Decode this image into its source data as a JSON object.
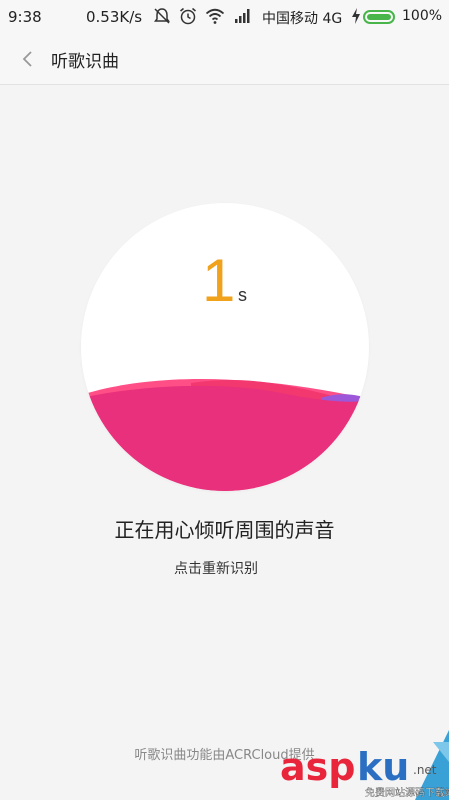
{
  "status_bar": {
    "time": "9:38",
    "speed": "0.53K/s",
    "carrier": "中国移动 4G",
    "battery": "100%",
    "icons": [
      "mute-icon",
      "alarm-icon",
      "wifi-icon",
      "signal-icon",
      "charging-icon",
      "battery-icon"
    ],
    "battery_color": "#48b54a"
  },
  "header": {
    "title": "听歌识曲",
    "back_icon": "chevron-left-icon"
  },
  "recognizer": {
    "count": "1",
    "unit": "s",
    "count_color": "#f0a21c",
    "wave_colors": [
      "#e8307c",
      "#f2386e",
      "#ff4f86",
      "#9c58d8"
    ]
  },
  "main": {
    "status": "正在用心倾听周围的声音",
    "retry": "点击重新识别"
  },
  "footer": {
    "text": "听歌识曲功能由ACRCloud提供"
  },
  "watermark": {
    "brand": "asp ku",
    "domain": ".net",
    "tagline": "免费网站源码下载站"
  }
}
